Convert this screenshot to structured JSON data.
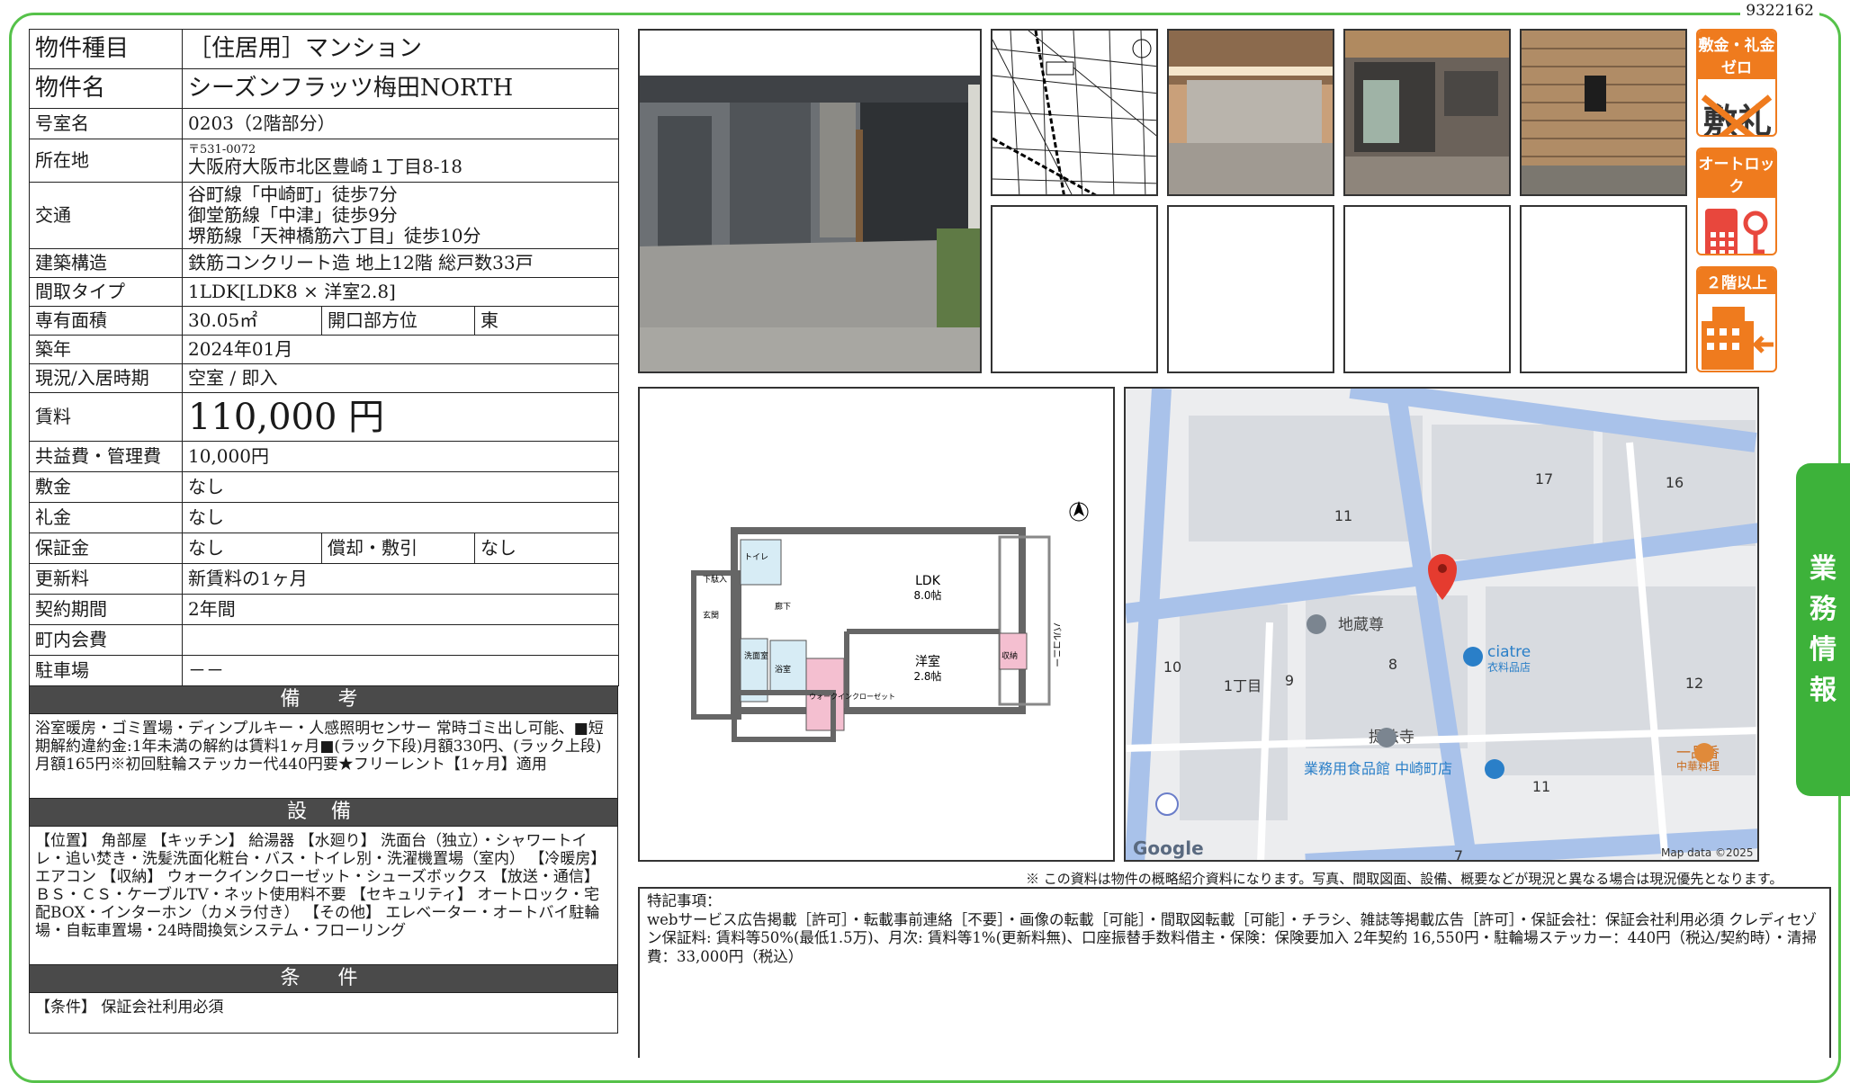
{
  "doc_id": "9322162",
  "property": [
    {
      "key": "物件種目",
      "value": "［住居用］マンション"
    },
    {
      "key": "物件名",
      "value": "シーズンフラッツ梅田NORTH"
    },
    {
      "key": "号室名",
      "value": "0203（2階部分）"
    },
    {
      "key": "所在地",
      "postal": "〒531-0072",
      "value": "大阪府大阪市北区豊崎１丁目8-18"
    },
    {
      "key": "交通",
      "lines": [
        "谷町線「中崎町」徒歩7分",
        "御堂筋線「中津」徒歩9分",
        "堺筋線「天神橋筋六丁目」徒歩10分"
      ]
    },
    {
      "key": "建築構造",
      "value": "鉄筋コンクリート造 地上12階 総戸数33戸"
    },
    {
      "key": "間取タイプ",
      "value": "1LDK[LDK8 × 洋室2.8]"
    },
    {
      "key": "専有面積",
      "value": "30.05㎡",
      "key2": "開口部方位",
      "value2": "東"
    },
    {
      "key": "築年",
      "value": "2024年01月"
    },
    {
      "key": "現況/入居時期",
      "value": "空室 / 即入"
    },
    {
      "key": "賃料",
      "value": "110,000 円"
    },
    {
      "key": "共益費・管理費",
      "value": "10,000円"
    },
    {
      "key": "敷金",
      "value": "なし"
    },
    {
      "key": "礼金",
      "value": "なし"
    },
    {
      "key": "保証金",
      "value": "なし",
      "key2": "償却・敷引",
      "value2": "なし"
    },
    {
      "key": "更新料",
      "value": "新賃料の1ヶ月"
    },
    {
      "key": "契約期間",
      "value": "2年間"
    },
    {
      "key": "町内会費",
      "value": ""
    },
    {
      "key": "駐車場",
      "value": "－－"
    }
  ],
  "bikou_title": "備　考",
  "bikou_text": "浴室暖房・ゴミ置場・ディンプルキー・人感照明センサー 常時ゴミ出し可能、■短期解約違約金:1年未満の解約は賃料1ヶ月■(ラック下段)月額330円、(ラック上段)月額165円※初回駐輪ステッカー代440円要★フリーレント【1ヶ月】適用",
  "setsubi_title": "設 備",
  "setsubi_text": "【位置】 角部屋 【キッチン】 給湯器 【水廻り】 洗面台（独立）・シャワートイレ・追い焚き・洗髪洗面化粧台・バス・トイレ別・洗濯機置場（室内） 【冷暖房】 エアコン 【収納】 ウォークインクローゼット・シューズボックス 【放送・通信】 ＢＳ・ＣＳ・ケーブルTV・ネット使用料不要 【セキュリティ】 オートロック・宅配BOX・インターホン（カメラ付き） 【その他】 エレベーター・オートバイ駐輪場・自転車置場・24時間換気システム・フローリング",
  "jouken_title": "条　件",
  "jouken_text": "【条件】 保証会社利用必須",
  "badges": [
    {
      "label": "敷金・礼金ゼロ",
      "icon": "no-deposit-icon"
    },
    {
      "label": "オートロック",
      "icon": "autolock-icon"
    },
    {
      "label": "２階以上",
      "icon": "upper-floor-building-icon"
    }
  ],
  "side_tab": [
    "業",
    "務",
    "情",
    "報"
  ],
  "floorplan": {
    "ldk": "LDK",
    "ldk_size": "8.0帖",
    "western": "洋室",
    "western_size": "2.8帖",
    "balcony": "バルコニー",
    "genkan": "玄関",
    "geta": "下駄入",
    "toilet": "トイレ",
    "senmen": "洗面室",
    "yokushitsu": "浴室",
    "closet": "ウォークインクローゼット",
    "storage": "収納",
    "rouka": "廊下"
  },
  "map": {
    "labels": [
      "11",
      "17",
      "16",
      "10",
      "1丁目",
      "9",
      "8",
      "12",
      "11",
      "7"
    ],
    "places": [
      "地蔵尊",
      "ciatre",
      "衣料品店",
      "提法寺",
      "業務用食品館 中崎町店",
      "一品香",
      "中華料理"
    ],
    "attribution": "Map data ©2025",
    "brand": "Google"
  },
  "notice": "※ この資料は物件の概略紹介資料になります。写真、間取図面、設備、概要などが現況と異なる場合は現況優先となります。",
  "remarks_title": "特記事項：",
  "remarks_text": "webサービス広告掲載［許可］・転載事前連絡［不要］・画像の転載［可能］・間取図転載［可能］・チラシ、雑誌等掲載広告［許可］・保証会社：保証会社利用必須 クレディセゾン保証料: 賃料等50%(最低1.5万)、月次: 賃料等1%(更新料無)、口座振替手数料借主・保険：保険要加入 2年契約 16,550円・駐輪場ステッカー：440円（税込/契約時）・清掃費：33,000円（税込）",
  "colors": {
    "accent_green": "#3db23a",
    "badge_orange": "#ef7b1e",
    "section_header": "#4a4a4a"
  }
}
